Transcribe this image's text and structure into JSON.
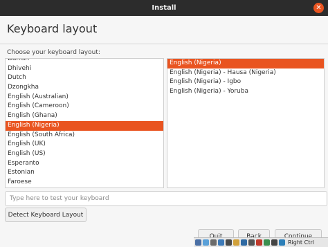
{
  "window": {
    "title": "Install",
    "close_glyph": "✕"
  },
  "page": {
    "title": "Keyboard layout",
    "prompt": "Choose your keyboard layout:"
  },
  "layouts": {
    "items": [
      "Danish",
      "Dhivehi",
      "Dutch",
      "Dzongkha",
      "English (Australian)",
      "English (Cameroon)",
      "English (Ghana)",
      "English (Nigeria)",
      "English (South Africa)",
      "English (UK)",
      "English (US)",
      "Esperanto",
      "Estonian",
      "Faroese"
    ],
    "selected": "English (Nigeria)"
  },
  "variants": {
    "items": [
      "English (Nigeria)",
      "English (Nigeria) - Hausa (Nigeria)",
      "English (Nigeria) - Igbo",
      "English (Nigeria) - Yoruba"
    ],
    "selected": "English (Nigeria)"
  },
  "test_input": {
    "placeholder": "Type here to test your keyboard",
    "value": ""
  },
  "buttons": {
    "detect": "Detect Keyboard Layout",
    "quit": "Quit",
    "back": "Back",
    "continue": "Continue"
  },
  "taskbar": {
    "host_key_label": "Right Ctrl",
    "icons": [
      {
        "name": "hard-disk-icon",
        "color": "#4a6fa5"
      },
      {
        "name": "optical-drive-icon",
        "color": "#5aa0d8"
      },
      {
        "name": "audio-icon",
        "color": "#6b6b6b"
      },
      {
        "name": "network-icon",
        "color": "#3d7ab8"
      },
      {
        "name": "usb-icon",
        "color": "#4a4a4a"
      },
      {
        "name": "shared-folder-icon",
        "color": "#d1a13b"
      },
      {
        "name": "display-icon",
        "color": "#2f6aa3"
      },
      {
        "name": "video-capture-icon",
        "color": "#555555"
      },
      {
        "name": "recording-icon",
        "color": "#c0392b"
      },
      {
        "name": "cpu-icon",
        "color": "#3b8f4f"
      },
      {
        "name": "mouse-integration-icon",
        "color": "#444444"
      },
      {
        "name": "keyboard-capture-icon",
        "color": "#2c7fb8"
      }
    ]
  },
  "colors": {
    "accent": "#e95420",
    "titlebar": "#2c2c2c"
  }
}
